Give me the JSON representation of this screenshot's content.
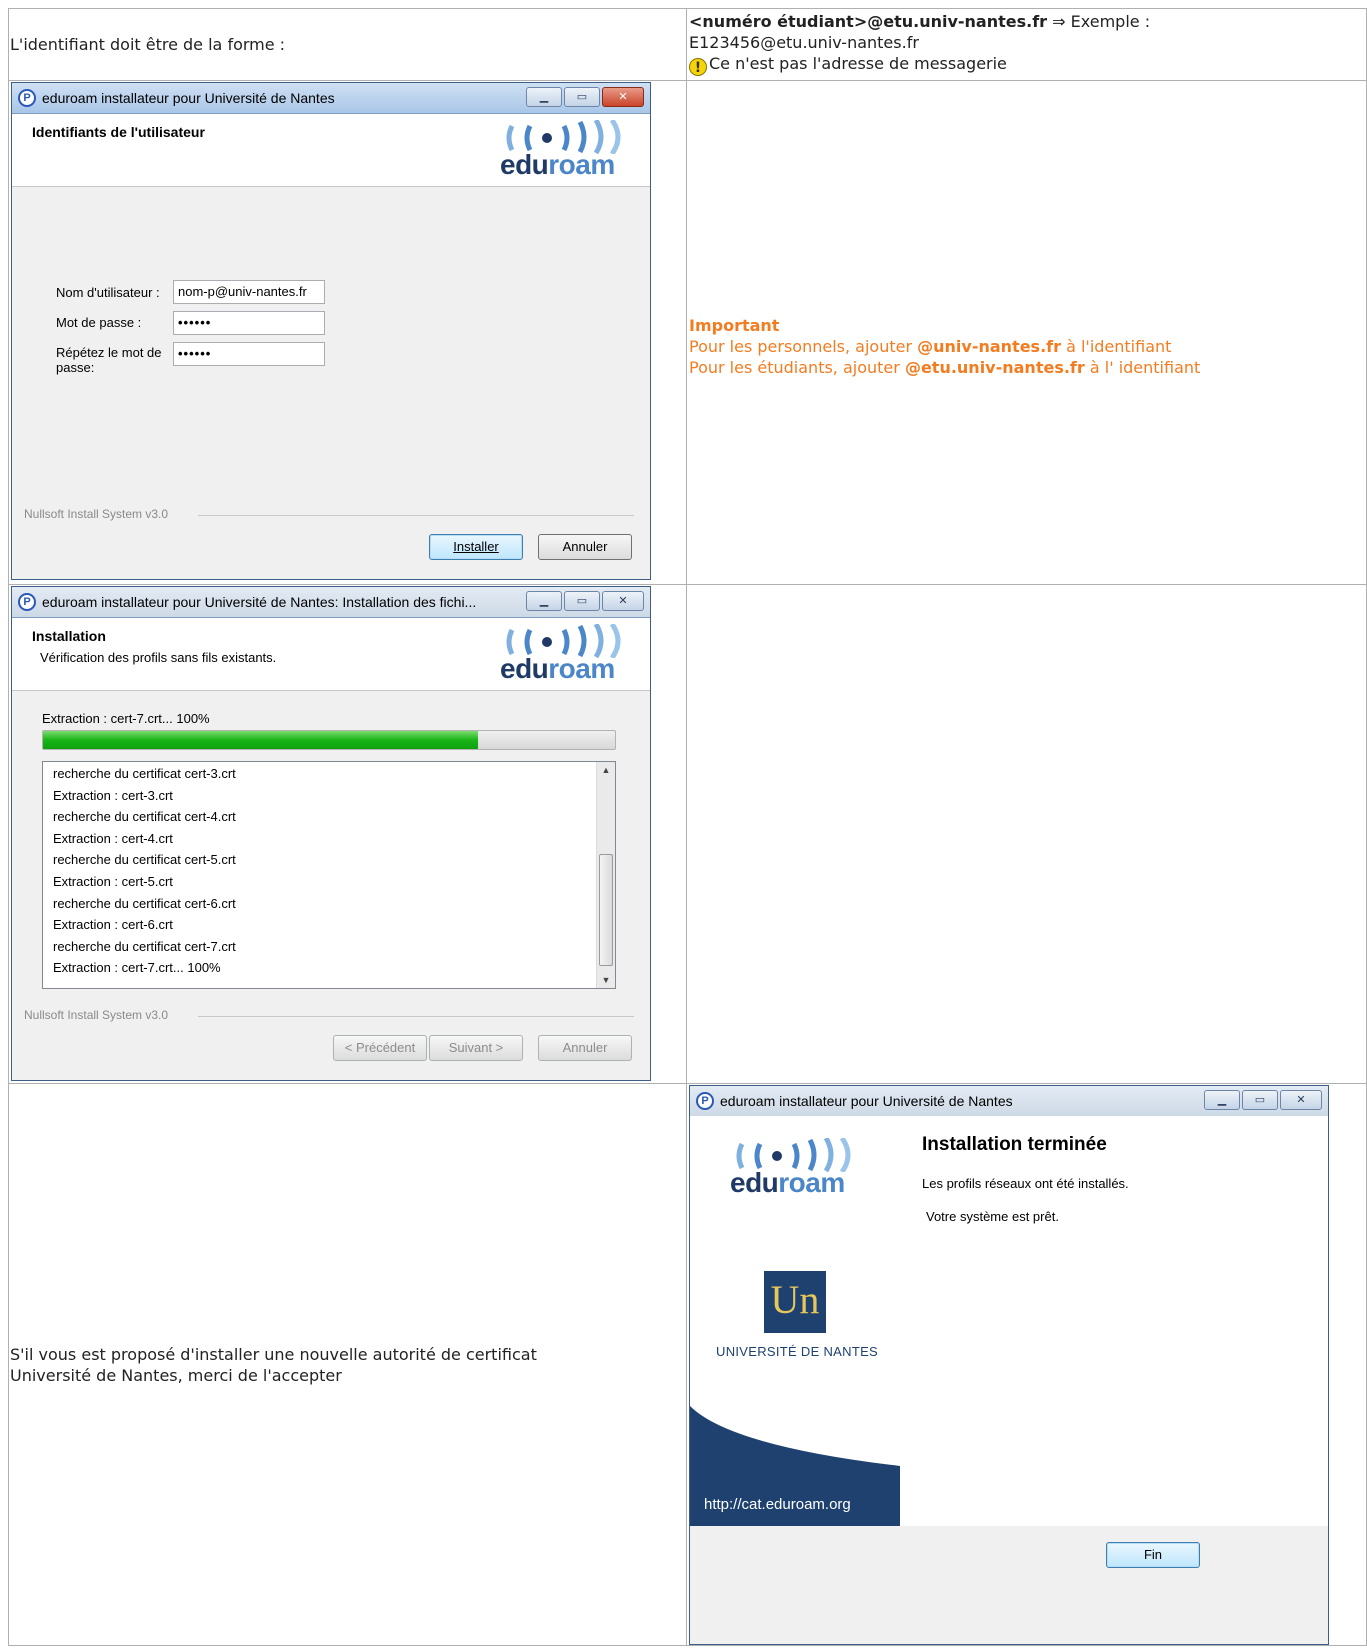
{
  "row1": {
    "left": "L'identifiant doit être de la forme :",
    "right_bold": "<numéro étudiant>@etu.univ-nantes.fr",
    "right_rest": " ⇒ Exemple :",
    "example": "E123456@etu.univ-nantes.fr",
    "warn_icon": "warning-icon",
    "warning": "Ce n'est pas l'adresse de messagerie"
  },
  "win1": {
    "title": "eduroam installateur pour Université de Nantes",
    "header_title": "Identifiants de l'utilisateur",
    "logo_text_dark": "edu",
    "logo_text_light": "roam",
    "username_label": "Nom d'utilisateur :",
    "username_value": "nom-p@univ-nantes.fr",
    "password_label": "Mot de passe :",
    "password_value": "••••••",
    "repeat_label_1": "Répétez le mot de",
    "repeat_label_2": "passe:",
    "repeat_value": "••••••",
    "footer": "Nullsoft Install System v3.0",
    "install_btn": "Installer",
    "cancel_btn": "Annuler"
  },
  "important": {
    "title": "Important",
    "line1_pre": "Pour les personnels, ajouter ",
    "line1_bold": "@univ-nantes.fr",
    "line1_post": " à l'identifiant",
    "line2_pre": "Pour les étudiants, ajouter ",
    "line2_bold": "@etu.univ-nantes.fr",
    "line2_post": " à l' identifiant"
  },
  "win2": {
    "title": "eduroam installateur pour Université de Nantes: Installation des fichi...",
    "header_title": "Installation",
    "header_sub": "Vérification des profils sans fils existants.",
    "status": "Extraction : cert-7.crt... 100%",
    "progress_fraction": 0.76,
    "log": [
      "recherche du certificat cert-3.crt",
      "Extraction : cert-3.crt",
      "recherche du certificat cert-4.crt",
      "Extraction : cert-4.crt",
      "recherche du certificat cert-5.crt",
      "Extraction : cert-5.crt",
      "recherche du certificat cert-6.crt",
      "Extraction : cert-6.crt",
      "recherche du certificat cert-7.crt",
      "Extraction : cert-7.crt... 100%"
    ],
    "footer": "Nullsoft Install System v3.0",
    "prev_btn": "< Précédent",
    "next_btn": "Suivant >",
    "cancel_btn": "Annuler"
  },
  "row3": {
    "left_line1": "S'il vous est proposé d'installer une nouvelle autorité de certificat",
    "left_line2": "Université de Nantes, merci de l'accepter"
  },
  "win3": {
    "title": "eduroam installateur pour Université de Nantes",
    "heading": "Installation terminée",
    "line1": "Les profils réseaux ont été installés.",
    "line2": "Votre système est prêt.",
    "un_logo": "Un",
    "university": "UNIVERSITÉ DE NANTES",
    "url": "http://cat.eduroam.org",
    "finish_btn": "Fin"
  }
}
